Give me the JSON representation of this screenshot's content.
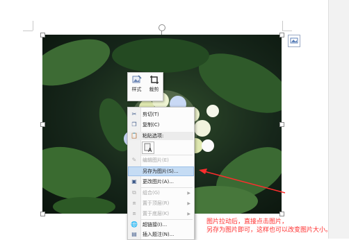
{
  "mini_toolbar": {
    "style_label": "样式",
    "crop_label": "裁剪"
  },
  "context_menu": {
    "items": [
      {
        "label": "剪切(T)",
        "icon": "scissors-icon",
        "enabled": true
      },
      {
        "label": "复制(C)",
        "icon": "copy-icon",
        "enabled": true
      },
      {
        "label": "粘贴选项:",
        "icon": "paste-icon",
        "enabled": true
      },
      {
        "label": "编辑图片(E)",
        "icon": "edit-picture-icon",
        "enabled": false
      },
      {
        "label": "另存为图片(S)...",
        "icon": "",
        "enabled": true
      },
      {
        "label": "更改图片(A)...",
        "icon": "change-picture-icon",
        "enabled": true
      },
      {
        "label": "组合(G)",
        "icon": "group-icon",
        "enabled": false
      },
      {
        "label": "置于顶层(R)",
        "icon": "bring-to-front-icon",
        "enabled": false
      },
      {
        "label": "置于底层(K)",
        "icon": "send-to-back-icon",
        "enabled": false
      },
      {
        "label": "超链接(I)...",
        "icon": "hyperlink-icon",
        "enabled": true
      },
      {
        "label": "插入题注(N)...",
        "icon": "caption-icon",
        "enabled": true
      }
    ],
    "highlighted_item": "另存为图片(S)...",
    "highlight_color": "#c5dcf4"
  },
  "annotation": {
    "line1": "图片拉动后，直接点击图片，",
    "line2": "另存为图片即可，这样也可以改变图片大小。",
    "color": "#ff2d2d"
  }
}
